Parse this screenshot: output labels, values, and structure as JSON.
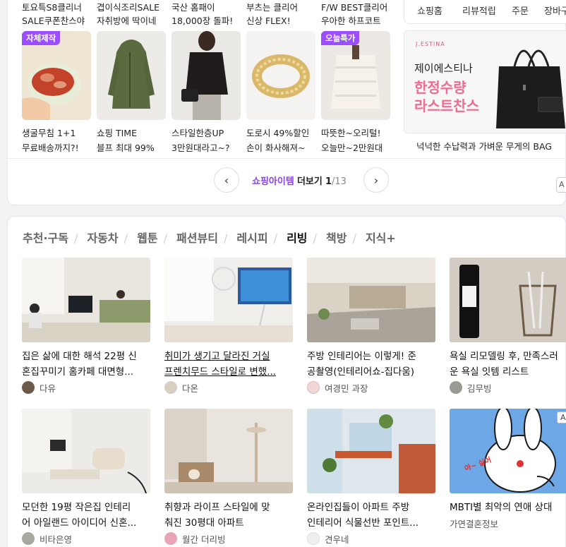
{
  "shop": {
    "row1": [
      {
        "l1": "토요특S8클리너",
        "l2": "SALE쿠폰찬스야"
      },
      {
        "l1": "겹이식조리SALE",
        "l2": "자취방에 딱이네"
      },
      {
        "l1": "국산 홈패이",
        "l2": "18,000장 돌파!"
      },
      {
        "l1": "부츠는 클리어",
        "l2": "신상 FLEX!"
      },
      {
        "l1": "F/W BEST클리어",
        "l2": "우아한 하프코트"
      }
    ],
    "items": [
      {
        "badge": "자체제작",
        "l1": "생굴무침 1+1",
        "l2": "무료배송까지?!"
      },
      {
        "badge": "",
        "l1": "쇼핑 TIME",
        "l2": "블프 최대 99%"
      },
      {
        "badge": "",
        "l1": "스타일한층UP",
        "l2": "3만원대라고~?"
      },
      {
        "badge": "",
        "l1": "도로시 49%할인",
        "l2": "손이 화사해져~"
      },
      {
        "badge": "오늘특가",
        "l1": "따뜻한~오리털!",
        "l2": "오늘만~2만원대"
      }
    ],
    "pager": {
      "title": "쇼핑아이템",
      "more": "더보기",
      "current": "1",
      "total": "/13",
      "prev_icon": "‹",
      "next_icon": "›"
    },
    "right_tabs": [
      "쇼핑홈",
      "리뷰적립",
      "주문",
      "장바구니"
    ],
    "ad": {
      "logo": "J.ESTINA",
      "name": "제이에스티나",
      "line1": "한정수량",
      "line2": "라스트찬스",
      "caption": "넉넉한 수납력과 가벼운 무게의 BAG"
    },
    "right_badge": "A"
  },
  "feed": {
    "tabs": [
      "추천·구독",
      "자동차",
      "웹툰",
      "패션뷰티",
      "레시피",
      "리빙",
      "책방",
      "지식+"
    ],
    "active_tab": "리빙",
    "cards": [
      {
        "l1": "집은 삶에 대한 해석 22평 신",
        "l2": "혼집꾸미기 홈카페 대면형...",
        "author": "다유",
        "ad": ""
      },
      {
        "l1": "취미가 생기고 달라진 거실",
        "l2": "프렌치무드 스타일로 변했...",
        "author": "다온",
        "ad": ""
      },
      {
        "l1": "주방 인테리어는 이렇게! 준",
        "l2": "공촬영(인테리어쇼-집다움)",
        "author": "여경민 과장",
        "ad": ""
      },
      {
        "l1": "욕실 리모델링 후, 만족스러",
        "l2": "운 욕실 잇템 리스트",
        "author": "김무빙",
        "ad": ""
      },
      {
        "l1": "모던한 19평 작은집 인테리",
        "l2": "어 아일랜드 아이디어 신혼...",
        "author": "비타은영",
        "ad": ""
      },
      {
        "l1": "취향과 라이프 스타일에 맞",
        "l2": "춰진 30평대 아파트",
        "author": "월간 더리빙",
        "ad": ""
      },
      {
        "l1": "온라인집들이 아파트 주방",
        "l2": "인테리어 식물선반 포인트...",
        "author": "견우네",
        "ad": ""
      },
      {
        "l1": "MBTI별 최악의 연애 상대",
        "l2": "",
        "author": "가연결혼정보",
        "ad": "AD"
      }
    ],
    "bunny_text": "아~ 싫어"
  },
  "colors": {
    "accent": "#8a44e8",
    "badge": "#9b4dff",
    "pink": "#ef6b8f"
  }
}
